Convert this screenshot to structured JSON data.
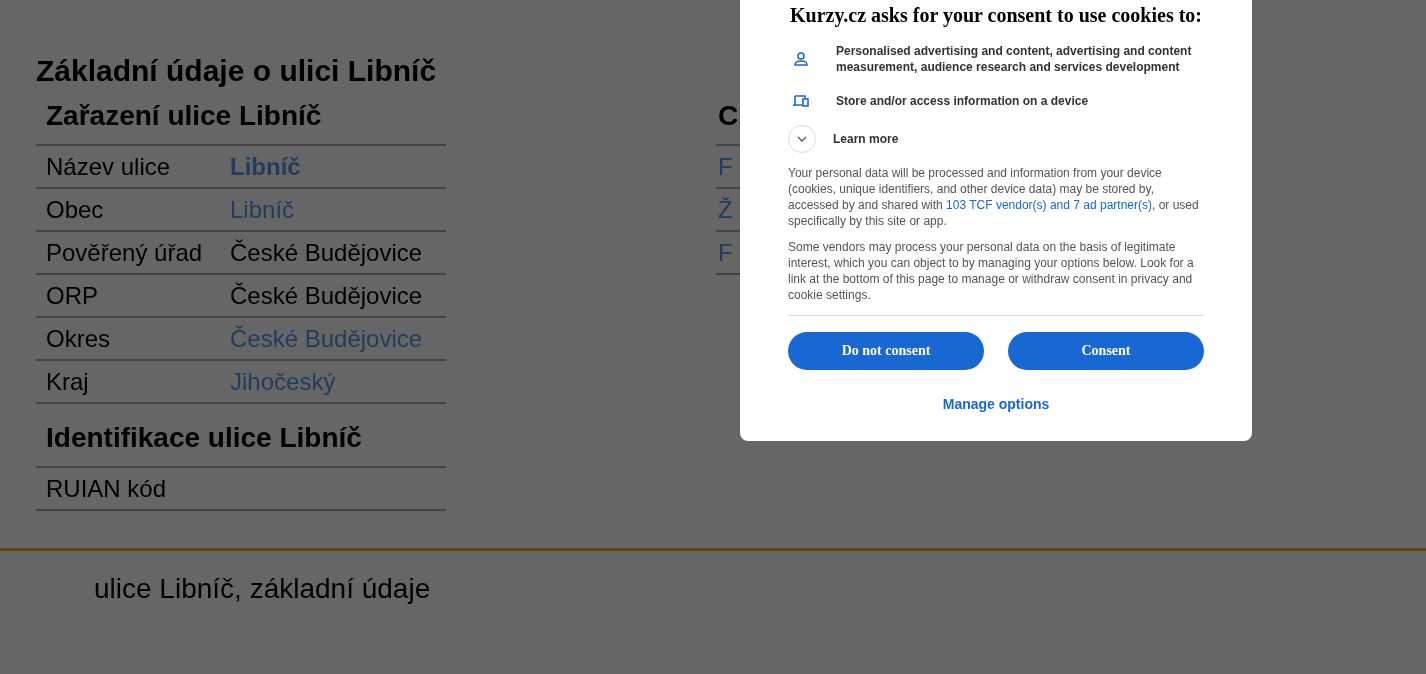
{
  "page": {
    "title": "Základní údaje o ulici Libníč"
  },
  "sections": [
    {
      "heading": "Zařazení ulice Libníč",
      "rows": [
        {
          "label": "Název ulice",
          "value": "Libníč",
          "kind": "strong-link"
        },
        {
          "label": "Obec",
          "value": "Libníč",
          "kind": "link"
        },
        {
          "label": "Pověřený úřad",
          "value": "České Budějovice",
          "kind": "text"
        },
        {
          "label": "ORP",
          "value": "České Budějovice",
          "kind": "text"
        },
        {
          "label": "Okres",
          "value": "České Budějovice",
          "kind": "link"
        },
        {
          "label": "Kraj",
          "value": "Jihočeský",
          "kind": "link"
        }
      ]
    },
    {
      "heading": "Identifikace ulice Libníč",
      "rows": [
        {
          "label": "RUIAN kód"
        }
      ]
    }
  ],
  "side_section": {
    "heading": "C",
    "rows": [
      "F",
      "Ž",
      "F"
    ]
  },
  "footer": {
    "text": "ulice Libníč, základní údaje"
  },
  "consent_dialog": {
    "title": "Kurzy.cz asks for your consent to use cookies to:",
    "purposes": [
      {
        "kind": "person",
        "text": "Personalised advertising and content, advertising and content measurement, audience research and services development"
      },
      {
        "kind": "device",
        "text": "Store and/or access information on a device"
      }
    ],
    "learn_more": {
      "label": "Learn more",
      "expanded": false
    },
    "paragraph_1": {
      "before": "Your personal data will be processed and information from your device (cookies, unique identifiers, and other device data) may be stored by, accessed by and shared with ",
      "link": "103 TCF vendor(s) and 7 ad partner(s)",
      "after": ", or used specifically by this site or app."
    },
    "paragraph_2": "Some vendors may process your personal data on the basis of legitimate interest, which you can object to by managing your options below. Look for a link at the bottom of this page to manage or withdraw consent in privacy and cookie settings.",
    "buttons": [
      "Do not consent",
      "Consent"
    ],
    "manage_link": "Manage options"
  }
}
